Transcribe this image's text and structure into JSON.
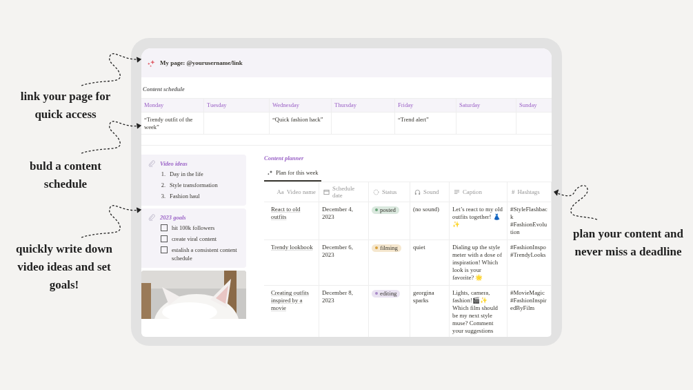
{
  "page": {
    "title": "My page: @yourusername/link"
  },
  "schedule": {
    "title": "Content schedule",
    "days": [
      {
        "day": "Monday",
        "entry": "“Trendy outfit of the week”"
      },
      {
        "day": "Tuesday"
      },
      {
        "day": "Wednesday",
        "entry": "“Quick fashion hack”"
      },
      {
        "day": "Thursday"
      },
      {
        "day": "Friday",
        "entry": "“Trend alert”"
      },
      {
        "day": "Saturday"
      },
      {
        "day": "Sunday"
      }
    ]
  },
  "video_ideas": {
    "title": "Video ideas",
    "items": [
      {
        "number": "1.",
        "text": "Day in the life"
      },
      {
        "number": "2.",
        "text": "Style transformation"
      },
      {
        "number": "3.",
        "text": "Fashion haul"
      }
    ]
  },
  "goals": {
    "title": "2023 goals",
    "items": [
      {
        "text": "hit 100k followers",
        "checked": false
      },
      {
        "text": "create viral content",
        "checked": false
      },
      {
        "text": "estalish a consistent content schedule",
        "checked": false
      }
    ]
  },
  "planner": {
    "title": "Content planner",
    "tabs": [
      {
        "label": "Plan for this week",
        "selected": true
      }
    ],
    "columns": [
      {
        "label": "Video name",
        "icon_text": "Aa"
      },
      {
        "label": "Schedule date",
        "kind": "date"
      },
      {
        "label": "Status",
        "kind": "status"
      },
      {
        "label": "Sound",
        "kind": "sound"
      },
      {
        "label": "Caption",
        "kind": "text"
      },
      {
        "label": "Hashtags",
        "icon_text": "#"
      }
    ],
    "rows": [
      {
        "video_name": "React to old outfits",
        "date": "December 4, 2023",
        "status": {
          "label": "posted",
          "color": "#6aa57a"
        },
        "sound": "(no sound)",
        "caption": "Let’s react to my old outfits together! 👗✨",
        "hashtags": "#StyleFlashback #FashionEvolution"
      },
      {
        "video_name": "Trendy lookbook",
        "date": "December 6, 2023",
        "status": {
          "label": "filming",
          "color": "#d9a03a"
        },
        "sound": "quiet",
        "caption": "Dialing up the style meter with a dose of inspiration! Which look is your favorite? 🌟",
        "hashtags": "#FashionInspo #TrendyLooks"
      },
      {
        "video_name": "Creating outfits inspired by a movie",
        "date": "December 8, 2023",
        "status": {
          "label": "editing",
          "color": "#a98bc9"
        },
        "sound": "georgina sparks",
        "caption": "Lights, camera, fashion!🎬✨ Which film should be my next style muse? Comment your suggestions",
        "hashtags": "#MovieMagic #FashionInspiredByFilm"
      }
    ]
  },
  "callouts": [
    {
      "text": "link your page for quick access"
    },
    {
      "text": "buld a content schedule"
    },
    {
      "text": "quickly write down video ideas and set goals!"
    },
    {
      "text": "plan your content and never miss a deadline"
    }
  ]
}
